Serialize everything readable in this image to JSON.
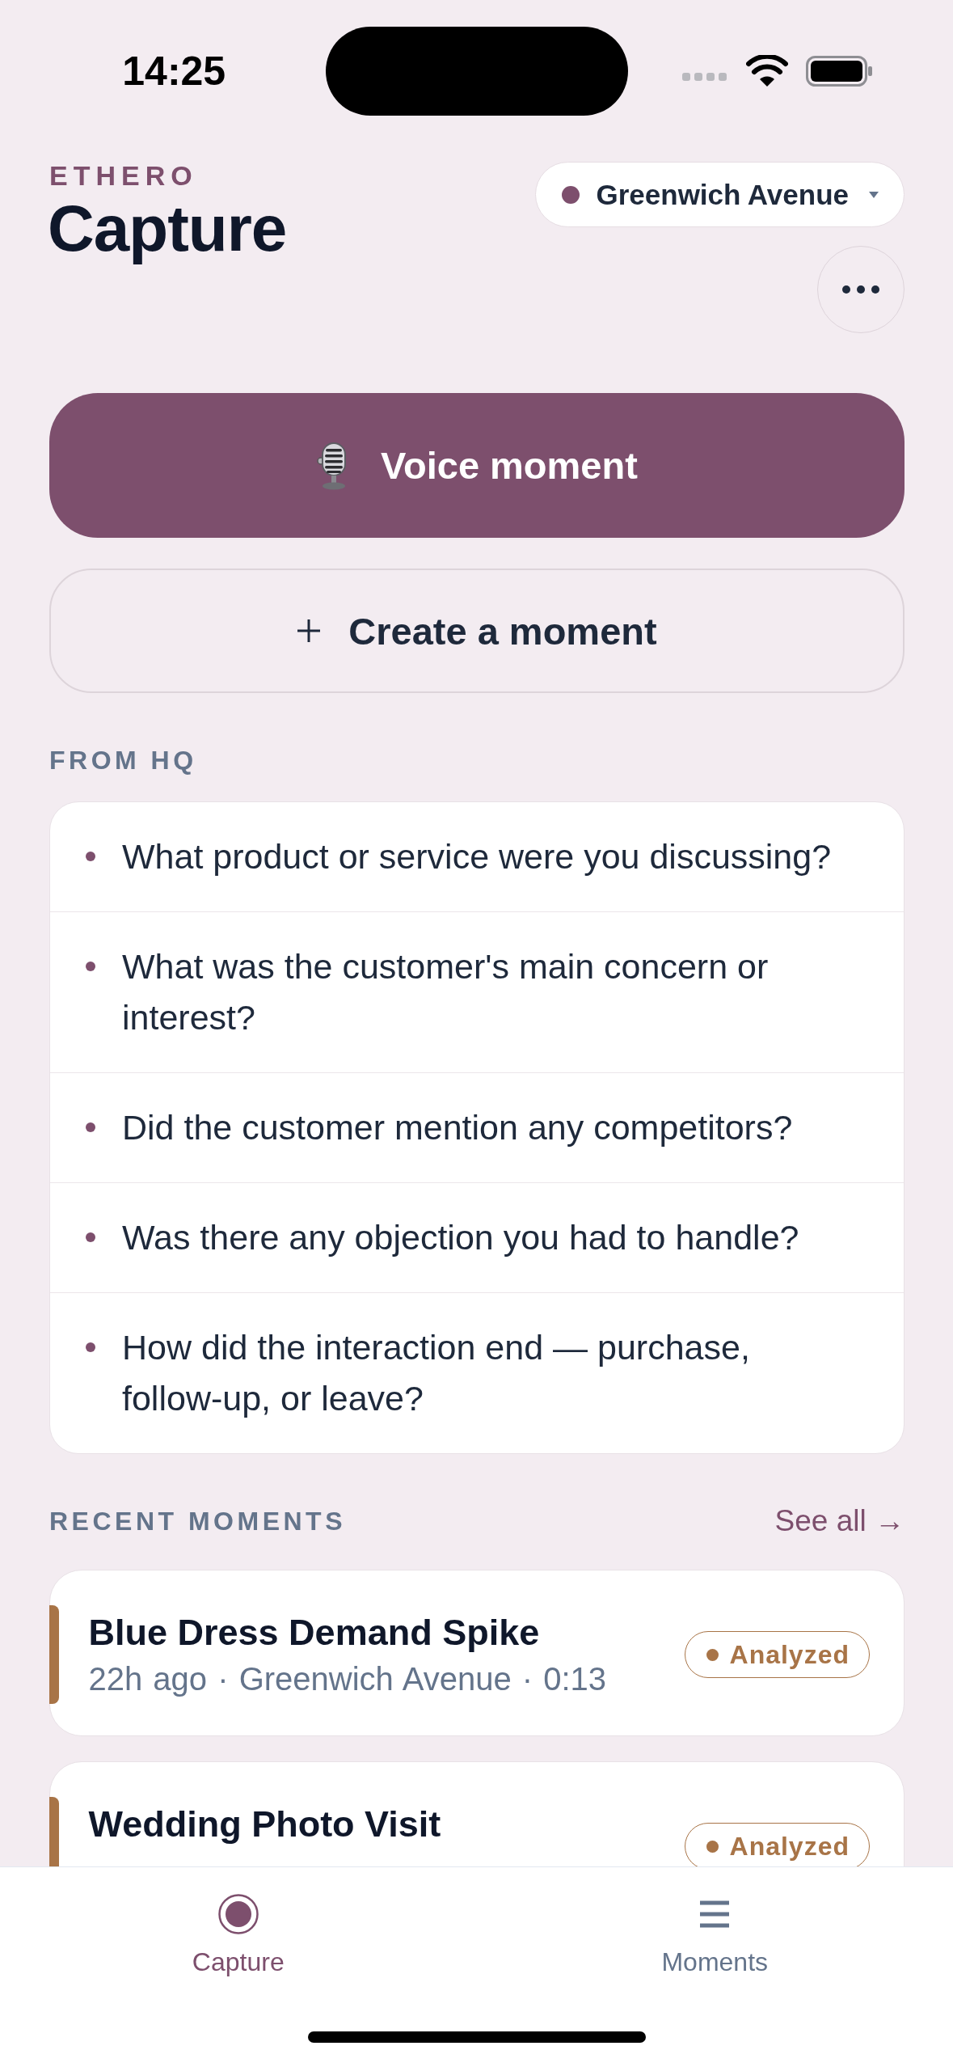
{
  "status_bar": {
    "time": "14:25"
  },
  "header": {
    "brand": "ETHERO",
    "title": "Capture",
    "location": "Greenwich Avenue"
  },
  "actions": [
    {
      "kind": "voice",
      "label": "Voice moment"
    },
    {
      "kind": "create",
      "label": "Create a moment"
    }
  ],
  "from_hq": {
    "heading": "FROM HQ",
    "questions": [
      "What product or service were you discussing?",
      "What was the customer's main concern or interest?",
      "Did the customer mention any competitors?",
      "Was there any objection you had to handle?",
      "How did the interaction end — purchase, follow-up, or leave?"
    ]
  },
  "recent_moments": {
    "heading": "RECENT MOMENTS",
    "see_all": "See all →",
    "moments": [
      {
        "title": "Blue Dress Demand Spike",
        "meta": "22h ago · Greenwich Avenue · 0:13",
        "status": "Analyzed",
        "color": "#a87447"
      },
      {
        "title": "Wedding Photo Visit",
        "status": "Analyzed",
        "color": "#a87447"
      }
    ]
  },
  "tab_bar": {
    "tabs": [
      {
        "label": "Capture",
        "selected": true
      },
      {
        "label": "Moments",
        "selected": false
      }
    ]
  }
}
